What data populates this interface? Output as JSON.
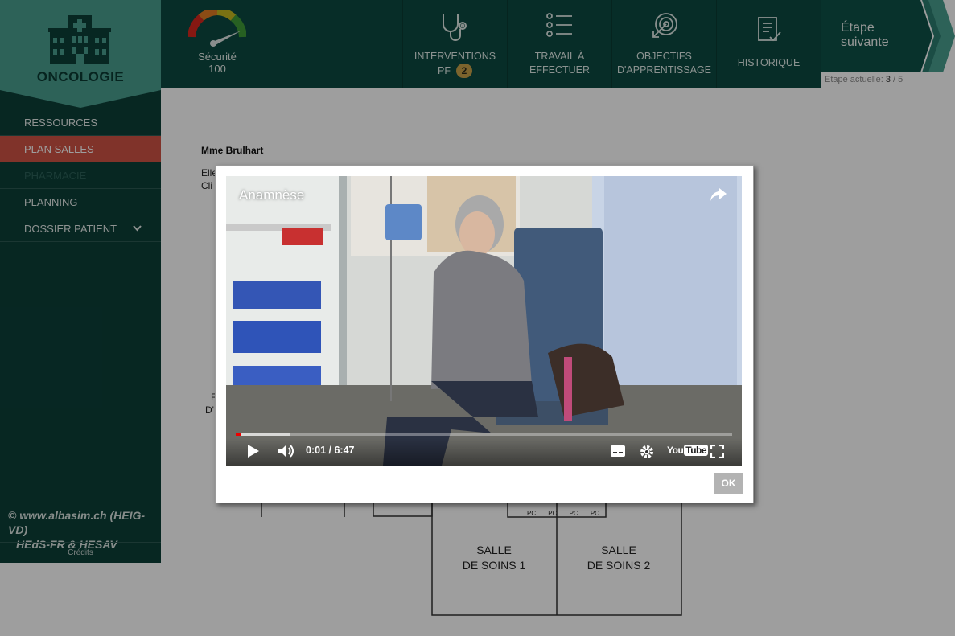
{
  "sidebar": {
    "logo_title": "ONCOLOGIE",
    "items": [
      {
        "label": "RESSOURCES"
      },
      {
        "label": "PLAN SALLES"
      },
      {
        "label": "PHARMACIE"
      },
      {
        "label": "PLANNING"
      },
      {
        "label": "DOSSIER PATIENT"
      }
    ],
    "copyright_line1": "© www.albasim.ch (HEIG-VD)",
    "copyright_line2": "HEdS-FR & HESAV",
    "credits": "Crédits"
  },
  "topbar": {
    "gauge": {
      "label": "Sécurité",
      "value": "100",
      "level_percent": 100
    },
    "tabs": [
      {
        "line1": "INTERVENTIONS",
        "line2": "PF",
        "badge": "2",
        "icon": "stethoscope-icon"
      },
      {
        "line1": "TRAVAIL À",
        "line2": "EFFECTUER",
        "icon": "checklist-icon"
      },
      {
        "line1": "OBJECTIFS",
        "line2": "D'APPRENTISSAGE",
        "icon": "target-icon"
      },
      {
        "line1": "HISTORIQUE",
        "line2": "",
        "icon": "document-check-icon"
      }
    ],
    "next_line1": "Étape",
    "next_line2": "suivante",
    "step_prefix": "Etape actuelle: ",
    "step_current": "3",
    "step_sep": " / ",
    "step_total": "5"
  },
  "content": {
    "patient_name": "Mme Brulhart",
    "frag1": "Elle",
    "frag2": "Cli",
    "frag3": "F",
    "frag4": "D'I",
    "room1_line1": "SALLE",
    "room1_line2": "DE SOINS 1",
    "room2_line1": "SALLE",
    "room2_line2": "DE SOINS 2",
    "pc_labels": [
      "PC",
      "PC",
      "PC",
      "PC"
    ]
  },
  "modal": {
    "video_title": "Anamnèse",
    "time_current": "0:01",
    "time_sep": " / ",
    "time_total": "6:47",
    "played_fraction": 0.01,
    "buffered_fraction": 0.11,
    "youtube_logo_a": "You",
    "youtube_logo_b": "Tube",
    "ok_label": "OK"
  },
  "colors": {
    "sidebar_bg": "#0c3f38",
    "topbar_bg": "#0c4a41",
    "logo_teal": "#4a9e8f",
    "active_item": "#cf5345",
    "badge": "#c9a24a",
    "progress_red": "#e00000"
  }
}
